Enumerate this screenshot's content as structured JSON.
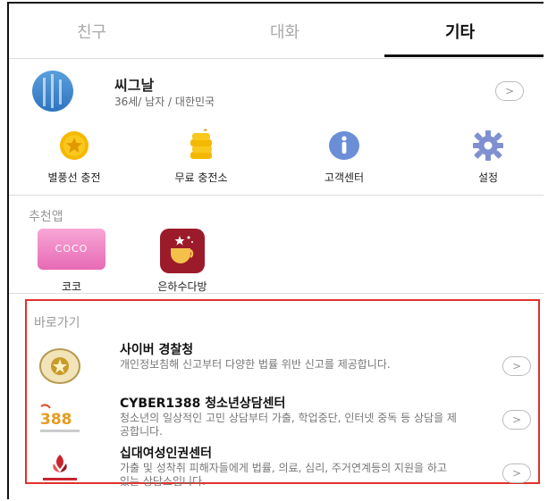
{
  "tabs": [
    {
      "label": "친구"
    },
    {
      "label": "대화"
    },
    {
      "label": "기타",
      "active": true
    }
  ],
  "profile": {
    "name": "씨그날",
    "info": "36세/ 남자 / 대한민국",
    "chevron": ">"
  },
  "menu": [
    {
      "label": "별풍선 충전",
      "icon": "star-coin-icon"
    },
    {
      "label": "무료 충전소",
      "icon": "coin-stack-icon"
    },
    {
      "label": "고객센터",
      "icon": "info-icon"
    },
    {
      "label": "설정",
      "icon": "gear-icon"
    }
  ],
  "recommended": {
    "title": "추천앱",
    "apps": [
      {
        "label": "코코",
        "tile_text": "COCO",
        "color": "#ee72b9"
      },
      {
        "label": "은하수다방",
        "color": "#9c1b2b"
      }
    ]
  },
  "shortcuts": {
    "title": "바로가기",
    "items": [
      {
        "title": "사이버 경찰청",
        "desc": "개인정보침해 신고부터 다양한 법률 위반 신고를 제공합니다.",
        "chevron": ">"
      },
      {
        "title": "CYBER1388 청소년상담센터",
        "desc": "청소년의 일상적인 고민 상담부터 가출, 학업중단, 인터넷 중독 등 상담을 제공합니다.",
        "chevron": ">"
      },
      {
        "title": "십대여성인권센터",
        "desc": "가출 및 성착취 피해자들에게 법률, 의료, 심리, 주거연계등의 지원을 하고 있는 상담소입니다.",
        "chevron": ">"
      }
    ]
  },
  "colors": {
    "highlight_border": "#e0312b",
    "star_coin": "#f5b800",
    "info_icon": "#6b8fd6",
    "gear_icon": "#7f8fd0"
  }
}
